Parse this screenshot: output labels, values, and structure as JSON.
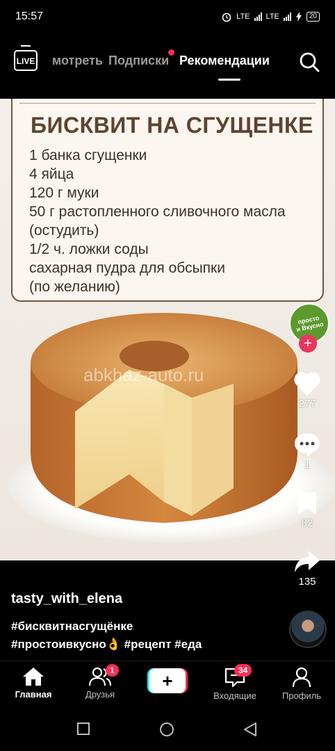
{
  "status_bar": {
    "time": "15:57",
    "network_1": "LTE",
    "network_2": "LTE",
    "battery": "20"
  },
  "top_nav": {
    "live_label": "LIVE",
    "tabs": [
      {
        "label": "Смотреть",
        "visible_text": "мотреть"
      },
      {
        "label": "Подписки"
      },
      {
        "label": "Рекомендации"
      }
    ],
    "active_tab": "Рекомендации"
  },
  "video": {
    "recipe_title": "БИСКВИТ НА СГУЩЕНКЕ",
    "recipe_lines": [
      "1 банка сгущенки",
      "4 яйца",
      "120 г муки",
      "50 г растопленного сливочного масла",
      "(остудить)",
      "1/2 ч. ложки соды",
      "сахарная пудра для обсыпки",
      "(по желанию)"
    ],
    "watermark": "abkhaz-auto.ru"
  },
  "creator_badge": {
    "text": "просто\nи Вкусно"
  },
  "actions": {
    "likes": "277",
    "comments": "1",
    "saves": "82",
    "shares": "135"
  },
  "post": {
    "username": "tasty_with_elena",
    "caption_line1": "#бисквитнасгущёнке",
    "caption_line2": "#простоивкусно👌 #рецепт #еда"
  },
  "tabbar": {
    "home": "Главная",
    "friends": "Друзья",
    "friends_badge": "1",
    "inbox": "Входящие",
    "inbox_badge": "34",
    "profile": "Профиль",
    "create_symbol": "+"
  },
  "colors": {
    "accent": "#fe2c55",
    "cyan": "#25f4ee",
    "background": "#000000"
  }
}
